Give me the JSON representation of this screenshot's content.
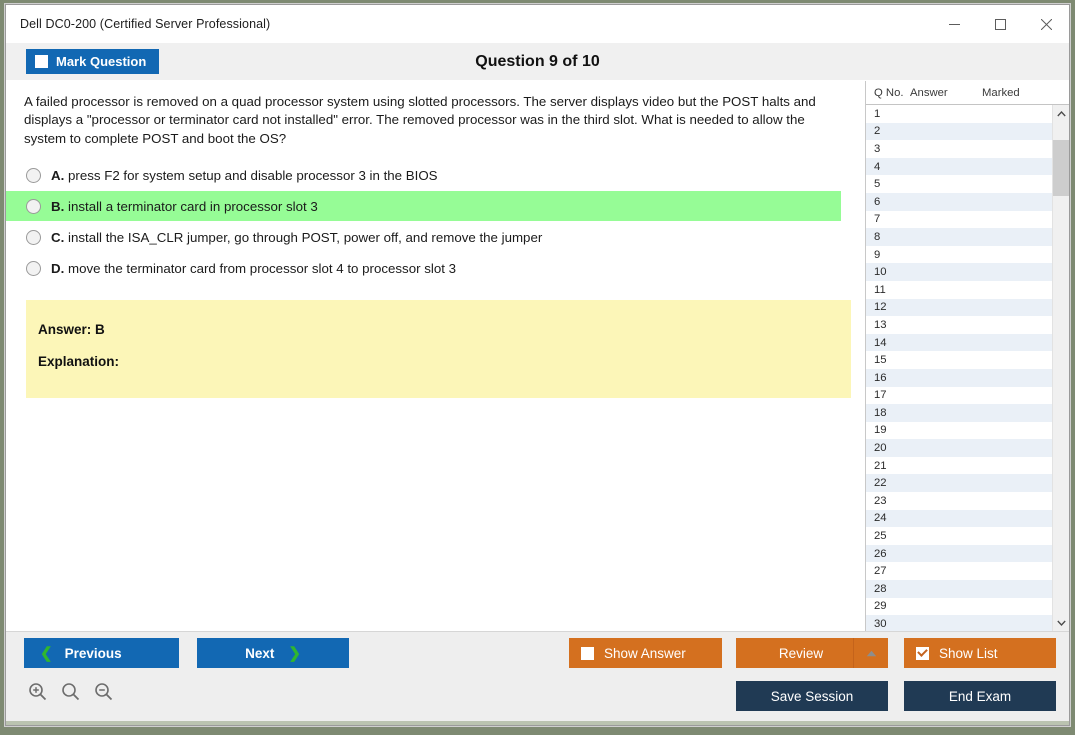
{
  "window": {
    "title": "Dell DC0-200 (Certified Server Professional)",
    "controls": [
      {
        "name": "minimize",
        "glyph": "minimize-icon"
      },
      {
        "name": "maximize",
        "glyph": "maximize-icon"
      },
      {
        "name": "close",
        "glyph": "close-icon"
      }
    ]
  },
  "header": {
    "mark_question_label": "Mark Question",
    "mark_question_checked": false,
    "question_counter": "Question 9 of 10"
  },
  "question": {
    "text": "A failed processor is removed on a quad processor system using slotted processors. The server displays video but the POST halts and displays a \"processor or terminator card not installed\" error. The removed processor was in the third slot. What is needed to allow the system to complete POST and boot the OS?",
    "options": [
      {
        "letter": "A.",
        "text": "press F2 for system setup and disable processor 3 in the BIOS",
        "highlighted": false,
        "selected": false
      },
      {
        "letter": "B.",
        "text": "install a terminator card in processor slot 3",
        "highlighted": true,
        "selected": false
      },
      {
        "letter": "C.",
        "text": "install the ISA_CLR jumper, go through POST, power off, and remove the jumper",
        "highlighted": false,
        "selected": false
      },
      {
        "letter": "D.",
        "text": "move the terminator card from processor slot 4 to processor slot 3",
        "highlighted": false,
        "selected": false
      }
    ]
  },
  "answer_panel": {
    "answer_line": "Answer: B",
    "explanation_line": "Explanation:"
  },
  "question_list": {
    "columns": [
      "Q No.",
      "Answer",
      "Marked"
    ],
    "rows": [
      {
        "no": "1",
        "answer": "",
        "marked": ""
      },
      {
        "no": "2",
        "answer": "",
        "marked": ""
      },
      {
        "no": "3",
        "answer": "",
        "marked": ""
      },
      {
        "no": "4",
        "answer": "",
        "marked": ""
      },
      {
        "no": "5",
        "answer": "",
        "marked": ""
      },
      {
        "no": "6",
        "answer": "",
        "marked": ""
      },
      {
        "no": "7",
        "answer": "",
        "marked": ""
      },
      {
        "no": "8",
        "answer": "",
        "marked": ""
      },
      {
        "no": "9",
        "answer": "",
        "marked": ""
      },
      {
        "no": "10",
        "answer": "",
        "marked": ""
      },
      {
        "no": "11",
        "answer": "",
        "marked": ""
      },
      {
        "no": "12",
        "answer": "",
        "marked": ""
      },
      {
        "no": "13",
        "answer": "",
        "marked": ""
      },
      {
        "no": "14",
        "answer": "",
        "marked": ""
      },
      {
        "no": "15",
        "answer": "",
        "marked": ""
      },
      {
        "no": "16",
        "answer": "",
        "marked": ""
      },
      {
        "no": "17",
        "answer": "",
        "marked": ""
      },
      {
        "no": "18",
        "answer": "",
        "marked": ""
      },
      {
        "no": "19",
        "answer": "",
        "marked": ""
      },
      {
        "no": "20",
        "answer": "",
        "marked": ""
      },
      {
        "no": "21",
        "answer": "",
        "marked": ""
      },
      {
        "no": "22",
        "answer": "",
        "marked": ""
      },
      {
        "no": "23",
        "answer": "",
        "marked": ""
      },
      {
        "no": "24",
        "answer": "",
        "marked": ""
      },
      {
        "no": "25",
        "answer": "",
        "marked": ""
      },
      {
        "no": "26",
        "answer": "",
        "marked": ""
      },
      {
        "no": "27",
        "answer": "",
        "marked": ""
      },
      {
        "no": "28",
        "answer": "",
        "marked": ""
      },
      {
        "no": "29",
        "answer": "",
        "marked": ""
      },
      {
        "no": "30",
        "answer": "",
        "marked": ""
      }
    ]
  },
  "footer": {
    "previous_label": "Previous",
    "next_label": "Next",
    "show_answer_label": "Show Answer",
    "show_answer_checked": false,
    "review_label": "Review",
    "show_list_label": "Show List",
    "show_list_checked": true,
    "save_session_label": "Save Session",
    "end_exam_label": "End Exam",
    "zoom_tools": [
      "zoom-in-icon",
      "zoom-reset-icon",
      "zoom-out-icon"
    ]
  },
  "colors": {
    "primary_blue": "#1268b3",
    "accent_orange": "#d4701f",
    "navy": "#203a54",
    "highlight_green": "#96fc96",
    "answer_yellow": "#fcf6b8",
    "chevron_green": "#2fb62f"
  }
}
